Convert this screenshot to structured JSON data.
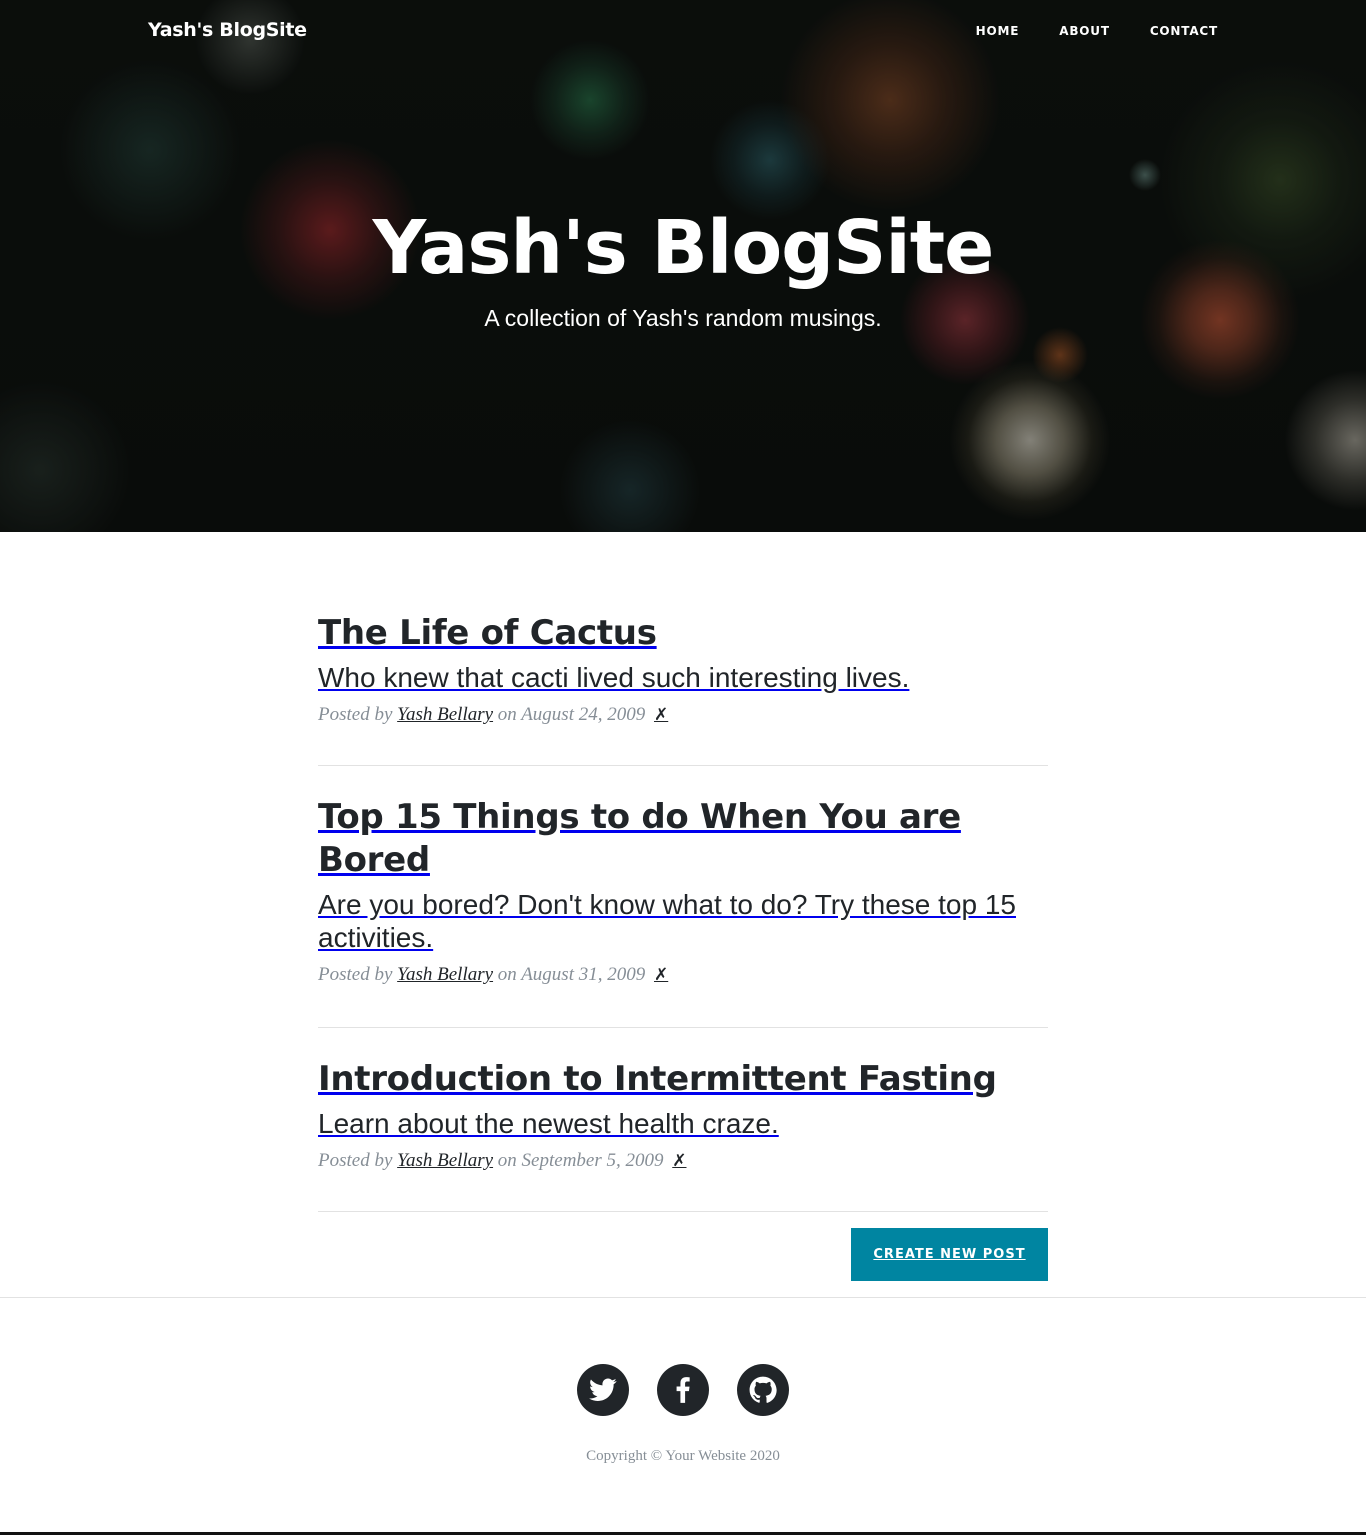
{
  "nav": {
    "brand": "Yash's BlogSite",
    "links": [
      "HOME",
      "ABOUT",
      "CONTACT"
    ]
  },
  "hero": {
    "heading": "Yash's BlogSite",
    "subheading": "A collection of Yash's random musings."
  },
  "posts": [
    {
      "title": "The Life of Cactus",
      "subtitle": "Who knew that cacti lived such interesting lives.",
      "posted_by": "Posted by",
      "author": "Yash Bellary",
      "date": "on August 24, 2009",
      "delete": "✗"
    },
    {
      "title": "Top 15 Things to do When You are Bored",
      "subtitle": "Are you bored? Don't know what to do? Try these top 15 activities.",
      "posted_by": "Posted by",
      "author": "Yash Bellary",
      "date": "on August 31, 2009",
      "delete": "✗"
    },
    {
      "title": "Introduction to Intermittent Fasting",
      "subtitle": "Learn about the newest health craze.",
      "posted_by": "Posted by",
      "author": "Yash Bellary",
      "date": "on September 5, 2009",
      "delete": "✗"
    }
  ],
  "create_button": "CREATE NEW POST",
  "footer": {
    "social_icons": [
      "twitter-icon",
      "facebook-icon",
      "github-icon"
    ],
    "copyright": "Copyright © Your Website 2020"
  },
  "colors": {
    "accent": "#0085a1",
    "text": "#212529",
    "muted": "#868e96"
  }
}
